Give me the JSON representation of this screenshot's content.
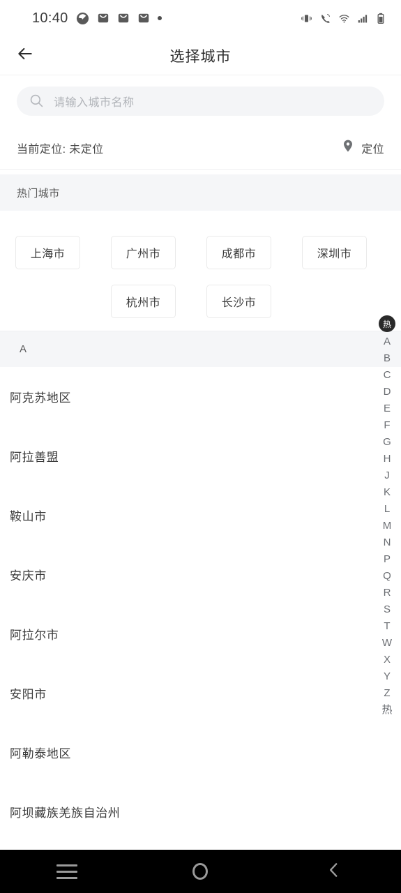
{
  "statusbar": {
    "time": "10:40",
    "left_icons": [
      "clock-icon",
      "mail-icon",
      "mail-icon",
      "mail-icon",
      "dot-icon"
    ],
    "right_icons": [
      "vibrate-icon",
      "wifi-calling-icon",
      "wifi-icon",
      "signal-icon",
      "battery-icon"
    ]
  },
  "header": {
    "title": "选择城市",
    "back_icon": "back-arrow-icon"
  },
  "search": {
    "placeholder": "请输入城市名称",
    "value": "",
    "icon": "search-icon"
  },
  "location": {
    "label": "当前定位: 未定位",
    "button_label": "定位",
    "button_icon": "location-pin-icon"
  },
  "hot_section": {
    "title": "热门城市",
    "rows": [
      [
        "上海市",
        "广州市",
        "成都市",
        "深圳市"
      ],
      [
        "",
        "杭州市",
        "长沙市",
        ""
      ]
    ]
  },
  "city_list": {
    "sections": [
      {
        "letter": "A",
        "cities": [
          "阿克苏地区",
          "阿拉善盟",
          "鞍山市",
          "安庆市",
          "阿拉尔市",
          "安阳市",
          "阿勒泰地区",
          "阿坝藏族羌族自治州"
        ]
      }
    ]
  },
  "index_bar": {
    "badge": "热",
    "letters": [
      "A",
      "B",
      "C",
      "D",
      "E",
      "F",
      "G",
      "H",
      "J",
      "K",
      "L",
      "M",
      "N",
      "P",
      "Q",
      "R",
      "S",
      "T",
      "W",
      "X",
      "Y",
      "Z",
      "热"
    ]
  },
  "navbar": {
    "recents_label": "recents",
    "home_label": "home",
    "back_label": "back"
  },
  "colors": {
    "page_bg": "#ffffff",
    "section_bg": "#f5f6f8",
    "search_bg": "#f4f5f7",
    "text_primary": "#3b3b3b",
    "text_secondary": "#6b6e73",
    "placeholder": "#b0b3b8",
    "chip_border": "#eaeaea",
    "navbar_bg": "#000000",
    "badge_bg": "#2a2a2a"
  }
}
